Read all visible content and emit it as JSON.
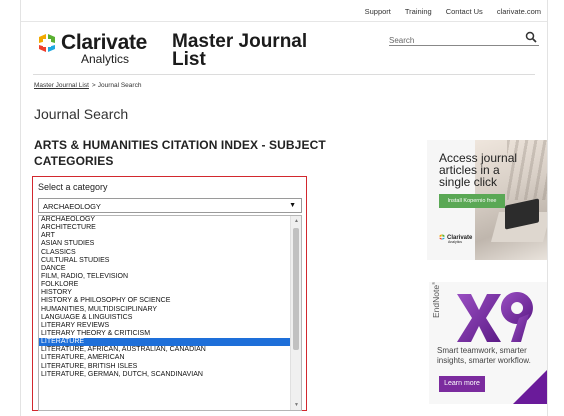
{
  "top_links": [
    "Support",
    "Training",
    "Contact Us",
    "clarivate.com"
  ],
  "logo": {
    "name": "Clarivate",
    "sub": "Analytics"
  },
  "site_title": "Master Journal List",
  "search": {
    "placeholder": "Search"
  },
  "breadcrumb": {
    "link": "Master Journal List",
    "separator": ">",
    "current": "Journal Search"
  },
  "page_title": "Journal Search",
  "heading": "ARTS & HUMANITIES CITATION INDEX - SUBJECT CATEGORIES",
  "category": {
    "label": "Select a category",
    "selected_value": "ARCHAEOLOGY",
    "options": [
      "ARCHAEOLOGY",
      "ARCHITECTURE",
      "ART",
      "ASIAN STUDIES",
      "CLASSICS",
      "CULTURAL STUDIES",
      "DANCE",
      "FILM, RADIO, TELEVISION",
      "FOLKLORE",
      "HISTORY",
      "HISTORY & PHILOSOPHY OF SCIENCE",
      "HUMANITIES, MULTIDISCIPLINARY",
      "LANGUAGE & LINGUISTICS",
      "LITERARY REVIEWS",
      "LITERARY THEORY & CRITICISM",
      "LITERATURE",
      "LITERATURE, AFRICAN, AUSTRALIAN, CANADIAN",
      "LITERATURE, AMERICAN",
      "LITERATURE, BRITISH ISLES",
      "LITERATURE, GERMAN, DUTCH, SCANDINAVIAN"
    ],
    "highlighted_index": 15
  },
  "ad_kopernio": {
    "text": "Access journal articles in a single click",
    "button": "Install Kopernio free",
    "brand": "Clarivate",
    "brand_sub": "Analytics"
  },
  "ad_endnote": {
    "product": "EndNote",
    "version_mark": "x9",
    "text": "Smart teamwork, smarter insights, smarter workflow.",
    "button": "Learn more",
    "accent": "#7b2b9e"
  },
  "colors": {
    "panel_border": "#d2282e",
    "selection": "#1e6fd9",
    "kopernio_button": "#5aa855"
  }
}
